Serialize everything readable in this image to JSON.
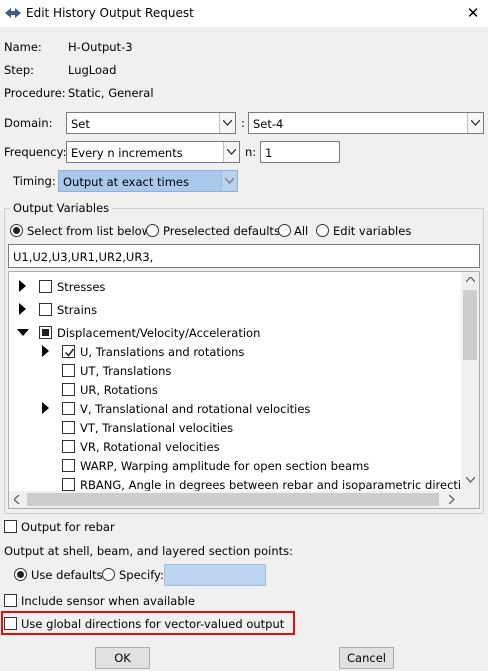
{
  "window": {
    "title": "Edit History Output Request"
  },
  "info": {
    "name_label": "Name:",
    "name_value": "H-Output-3",
    "step_label": "Step:",
    "step_value": "LugLoad",
    "procedure_label": "Procedure:",
    "procedure_value": "Static, General"
  },
  "domain": {
    "label": "Domain:",
    "type": "Set",
    "colon": ":",
    "set": "Set-4"
  },
  "frequency": {
    "label": "Frequency:",
    "value": "Every n increments",
    "n_label": "n:",
    "n_value": "1"
  },
  "timing": {
    "label": "Timing:",
    "value": "Output at exact times"
  },
  "output_variables": {
    "title": "Output Variables",
    "options": [
      "Select from list below",
      "Preselected defaults",
      "All",
      "Edit variables"
    ],
    "selected": "Select from list below",
    "text": "U1,U2,U3,UR1,UR2,UR3,"
  },
  "tree": [
    {
      "label": "Stresses",
      "level": 0,
      "expander": "collapsed",
      "state": "unchecked"
    },
    {
      "label": "Strains",
      "level": 0,
      "expander": "collapsed",
      "state": "unchecked"
    },
    {
      "label": "Displacement/Velocity/Acceleration",
      "level": 0,
      "expander": "expanded",
      "state": "partial"
    },
    {
      "label": "U, Translations and rotations",
      "level": 1,
      "expander": "collapsed",
      "state": "checked"
    },
    {
      "label": "UT, Translations",
      "level": 1,
      "expander": "none",
      "state": "unchecked"
    },
    {
      "label": "UR, Rotations",
      "level": 1,
      "expander": "none",
      "state": "unchecked"
    },
    {
      "label": "V, Translational and rotational velocities",
      "level": 1,
      "expander": "collapsed",
      "state": "unchecked"
    },
    {
      "label": "VT, Translational velocities",
      "level": 1,
      "expander": "none",
      "state": "unchecked"
    },
    {
      "label": "VR, Rotational velocities",
      "level": 1,
      "expander": "none",
      "state": "unchecked"
    },
    {
      "label": "WARP, Warping amplitude for open section beams",
      "level": 1,
      "expander": "none",
      "state": "unchecked"
    },
    {
      "label": "RBANG, Angle in degrees between rebar and isoparametric direction",
      "level": 1,
      "expander": "none",
      "state": "unchecked"
    }
  ],
  "options": {
    "rebar_label": "Output for rebar",
    "section_points_label": "Output at shell, beam, and layered section points:",
    "use_defaults_label": "Use defaults",
    "specify_label": "Specify:",
    "specify_value": "",
    "sensor_label": "Include sensor when available",
    "global_dir_label": "Use global directions for vector-valued output"
  },
  "buttons": {
    "ok": "OK",
    "cancel": "Cancel"
  },
  "colors": {
    "highlight_box": "#e01010",
    "timing_fill": "#a9c9ec",
    "specify_fill": "#bcd6f2"
  }
}
